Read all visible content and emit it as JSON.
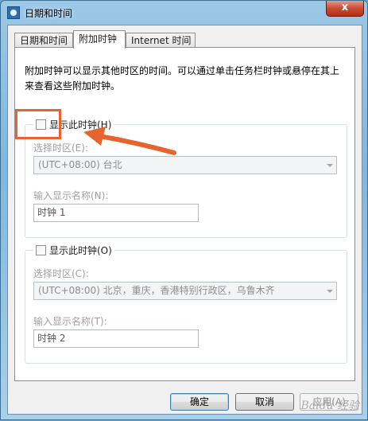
{
  "window": {
    "title": "日期和时间",
    "close_label": "x"
  },
  "tabs": [
    {
      "label": "日期和时间",
      "active": false
    },
    {
      "label": "附加时钟",
      "active": true
    },
    {
      "label": "Internet 时间",
      "active": false
    }
  ],
  "description": "附加时钟可以显示其他时区的时间。可以通过单击任务栏时钟或悬停在其上来查看这些附加时钟。",
  "clock1": {
    "checkbox_label": "显示此时钟(H)",
    "checked": false,
    "timezone_label": "选择时区(E):",
    "timezone_value": "(UTC+08:00) 台北",
    "name_label": "输入显示名称(N):",
    "name_value": "时钟 1"
  },
  "clock2": {
    "checkbox_label": "显示此时钟(O)",
    "checked": false,
    "timezone_label": "选择时区(C):",
    "timezone_value": "(UTC+08:00) 北京，重庆，香港特别行政区，乌鲁木齐",
    "name_label": "输入显示名称(T):",
    "name_value": "时钟 2"
  },
  "buttons": {
    "ok": "确定",
    "cancel": "取消",
    "apply": "应用(A)"
  },
  "annotation": {
    "color": "#e8642f"
  },
  "watermark": "Baidu 经验"
}
